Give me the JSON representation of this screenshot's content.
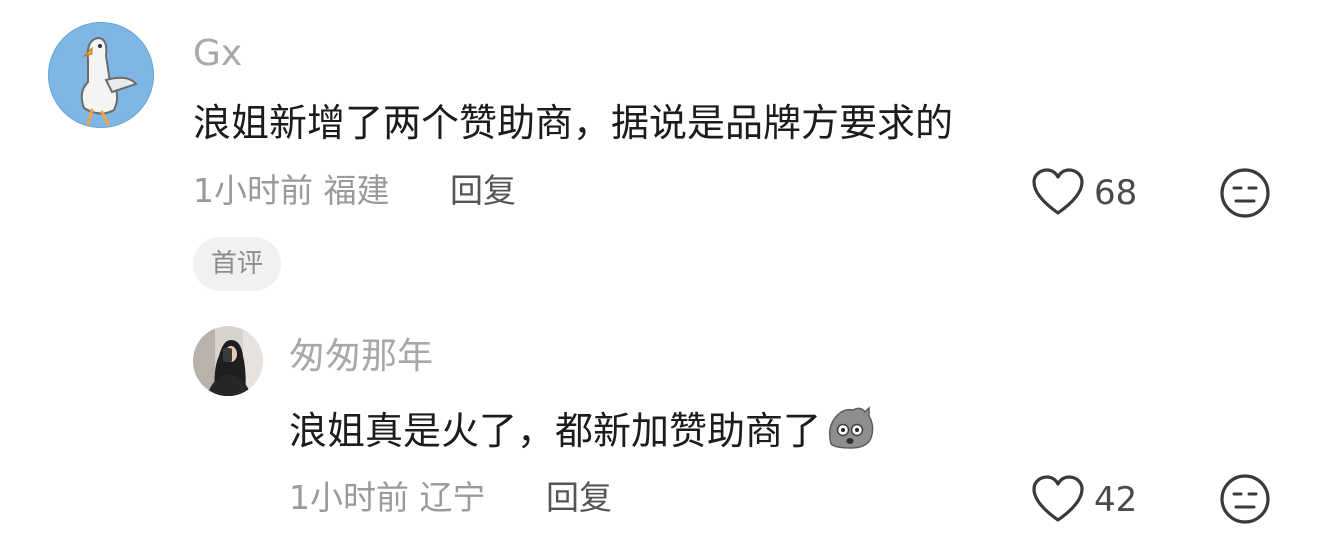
{
  "comments": [
    {
      "username": "Gx",
      "text": "浪姐新增了两个赞助商，据说是品牌方要求的",
      "time_location": "1小时前 福建",
      "reply_label": "回复",
      "likes": "68",
      "badge": "首评",
      "avatar_icon": "seagull-avatar"
    }
  ],
  "replies": [
    {
      "username": "匆匆那年",
      "text": "浪姐真是火了，都新加赞助商了",
      "emoji": "shocked-face-emoji",
      "time_location": "1小时前 辽宁",
      "reply_label": "回复",
      "likes": "42",
      "avatar_icon": "girl-selfie-avatar"
    }
  ],
  "colors": {
    "username": "#a8a8a8",
    "text": "#1c1c1c",
    "meta": "#9a9a9a",
    "badge_bg": "#f1f1f1",
    "avatar_bg": "#7fb6e4"
  }
}
